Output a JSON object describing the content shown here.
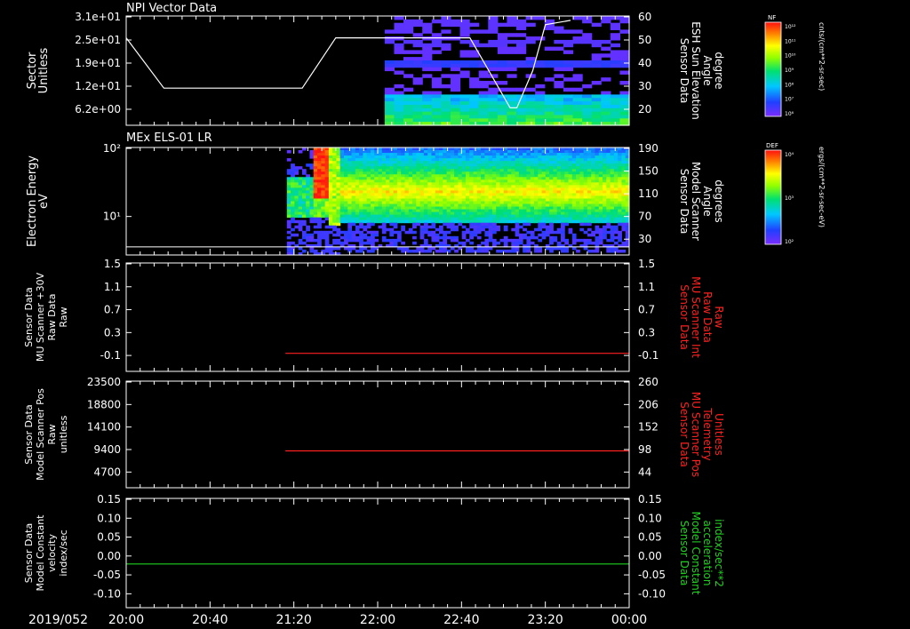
{
  "date_label": "2019/052",
  "time_ticks": [
    "20:00",
    "20:40",
    "21:20",
    "22:00",
    "22:40",
    "23:20",
    "00:00"
  ],
  "colorbars": [
    {
      "id": "nf",
      "title": "NF",
      "units": "cnts/(cm**2-sr-sec)",
      "ticks": [
        "10¹²",
        "10¹¹",
        "10¹⁰",
        "10⁹",
        "10⁸",
        "10⁷",
        "10⁶"
      ]
    },
    {
      "id": "def",
      "title": "DEF",
      "units": "ergs/(cm**2-sr-sec-eV)",
      "ticks": [
        "10⁴",
        "10³",
        "10²"
      ]
    }
  ],
  "chart_data": [
    {
      "type": "heatmap",
      "panel_title": "NPI Vector Data",
      "ylabel": [
        "Sector",
        "Unitless"
      ],
      "yticks_left": [
        "3.1e+01",
        "2.5e+01",
        "1.9e+01",
        "1.2e+01",
        "6.2e+00"
      ],
      "y2label": [
        "Sensor Data",
        "ESH Sun Elevation",
        "Angle",
        "degree"
      ],
      "y2ticks": [
        "60",
        "50",
        "40",
        "30",
        "20"
      ],
      "y2lim": [
        10,
        60
      ],
      "data_start": "23:05",
      "overlay_line": {
        "name": "ESH Sun Elevation Angle",
        "color": "#ffffff",
        "x_hours": [
          0.0,
          0.45,
          0.7,
          2.1,
          2.5,
          3.7,
          4.1,
          4.58,
          4.66,
          4.85,
          5.0,
          5.3
        ],
        "y": [
          50,
          27,
          27,
          27,
          50,
          50,
          50,
          18,
          18,
          35,
          56,
          58
        ]
      }
    },
    {
      "type": "heatmap",
      "panel_title": "MEx ELS-01 LR",
      "ylabel": [
        "Electron Energy",
        "eV"
      ],
      "yticks_left": [
        "10²",
        "10¹"
      ],
      "y2label": [
        "Sensor Data",
        "Model Scanner",
        "Angle",
        "degrees"
      ],
      "y2ticks": [
        "190",
        "150",
        "110",
        "70",
        "30"
      ],
      "y2lim": [
        0,
        190
      ],
      "data_start": "21:55",
      "overlay_line": {
        "name": "Model Scanner Angle",
        "color": "#ffffff",
        "x_hours": [
          0.0,
          6.0
        ],
        "y": [
          8,
          8
        ]
      }
    },
    {
      "type": "line",
      "ylabel": [
        "Sensor Data",
        "MU Scanner +30V",
        "Raw Data",
        "Raw"
      ],
      "yticks": [
        "1.5",
        "1.1",
        "0.7",
        "0.3",
        "-0.1"
      ],
      "ylim": [
        -0.3,
        1.5
      ],
      "y2label": [
        "Sensor Data",
        "MU Scanner Int",
        "Raw Data",
        "Raw"
      ],
      "y2ticks": [
        "1.5",
        "1.1",
        "0.7",
        "0.3",
        "-0.1"
      ],
      "series": [
        {
          "name": "MU Scanner Int Raw Data",
          "color": "#ff2020",
          "x_hours": [
            1.9,
            6.0
          ],
          "y": [
            0.0,
            0.0
          ]
        }
      ]
    },
    {
      "type": "line",
      "ylabel": [
        "Sensor Data",
        "Model Scanner Pos",
        "Raw",
        "unitless"
      ],
      "yticks": [
        "23500",
        "18800",
        "14100",
        "9400",
        "4700"
      ],
      "ylim": [
        0,
        23500
      ],
      "y2label": [
        "Sensor Data",
        "MU Scanner Pos",
        "Telemetry",
        "Unitless"
      ],
      "y2ticks": [
        "260",
        "206",
        "152",
        "98",
        "44"
      ],
      "y2lim": [
        0,
        260
      ],
      "series": [
        {
          "name": "MU Scanner Pos Telemetry",
          "color": "#ff2020",
          "x_hours": [
            1.9,
            6.0
          ],
          "y2": [
            90,
            90
          ]
        }
      ]
    },
    {
      "type": "line",
      "ylabel": [
        "Sensor Data",
        "Model Constant",
        "velocity",
        "index/sec"
      ],
      "yticks": [
        "0.15",
        "0.10",
        "0.05",
        "0.00",
        "-0.05",
        "-0.10"
      ],
      "ylim": [
        -0.1,
        0.15
      ],
      "y2label": [
        "Sensor Data",
        "Model Constant",
        "acceleration",
        "index/sec**2"
      ],
      "y2ticks": [
        "0.15",
        "0.10",
        "0.05",
        "0.00",
        "-0.05",
        "-0.10"
      ],
      "series": [
        {
          "name": "Model Constant acceleration",
          "color": "#20d020",
          "x_hours": [
            0.0,
            6.0
          ],
          "y": [
            0.0,
            0.0
          ]
        }
      ]
    }
  ]
}
